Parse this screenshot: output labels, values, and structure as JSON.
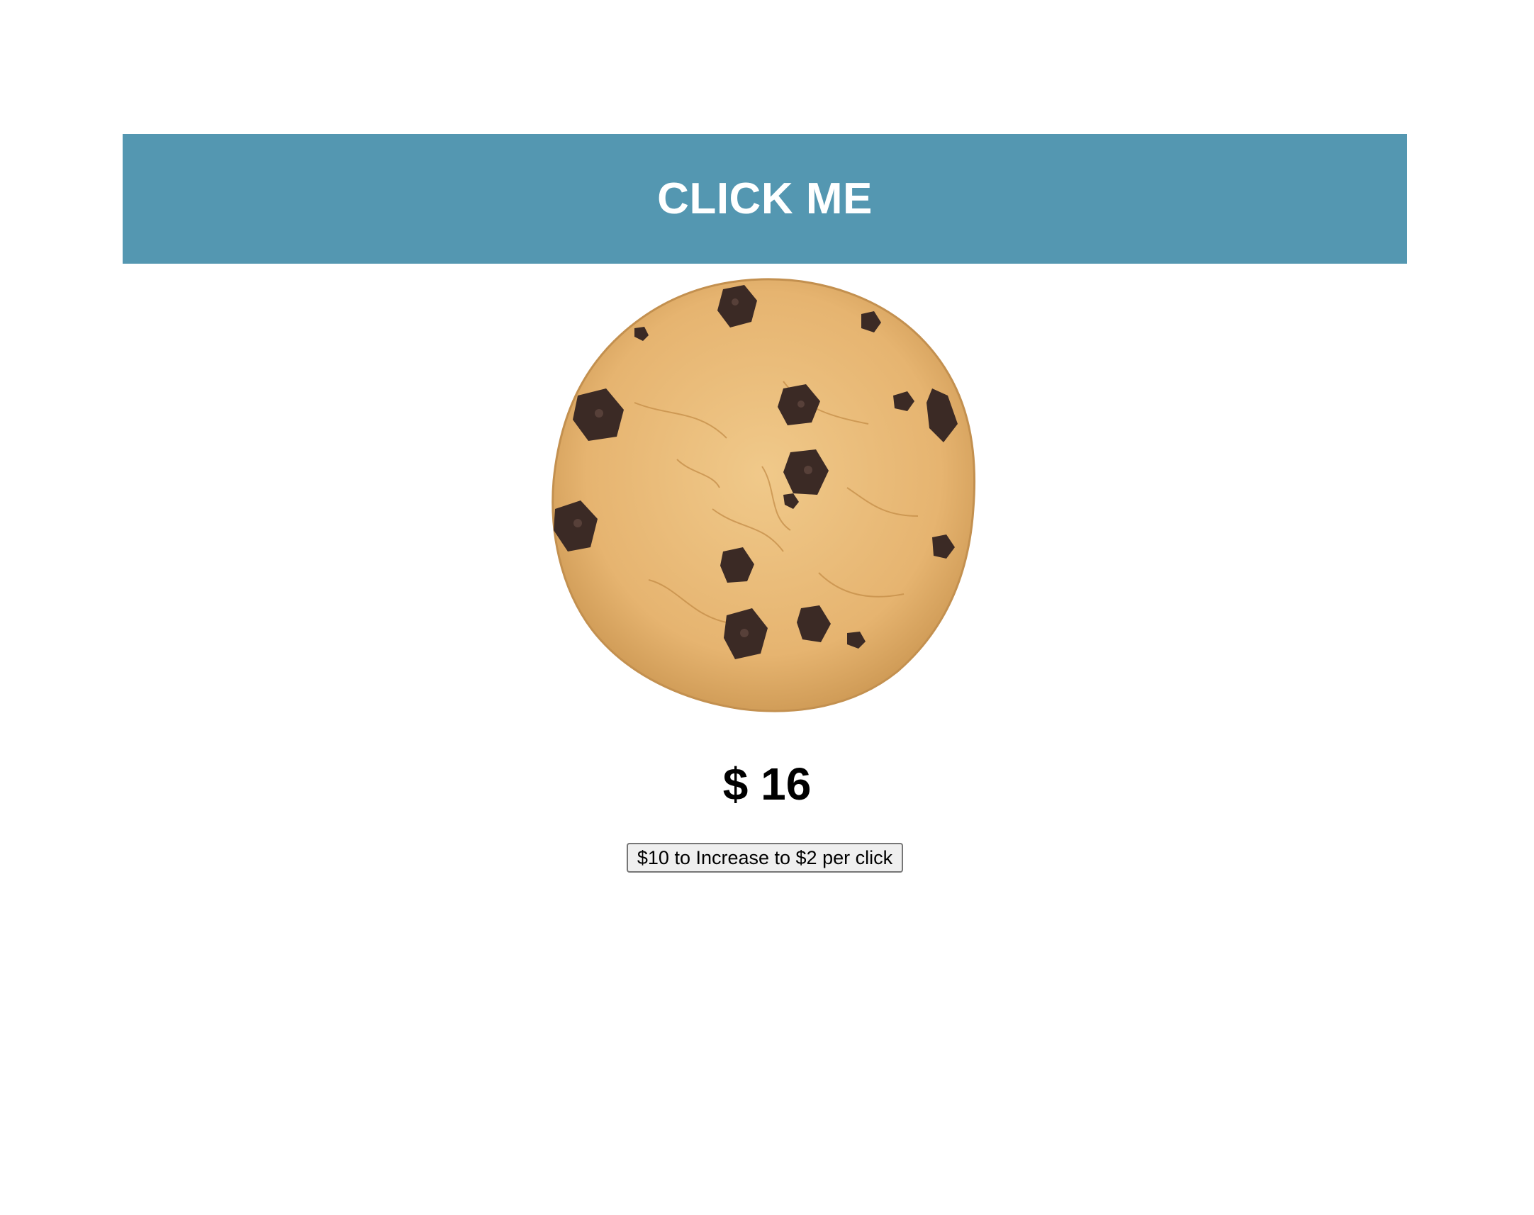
{
  "banner": {
    "title": "CLICK ME",
    "color": "#5497b1"
  },
  "cookie": {
    "icon": "chocolate-chip-cookie-image",
    "colors": {
      "dough": "#e8b876",
      "dough_edge": "#c99550",
      "chocolate": "#3b2a25"
    }
  },
  "money": {
    "text": "$ 16"
  },
  "upgrade": {
    "label": "$10 to Increase to $2 per click"
  }
}
